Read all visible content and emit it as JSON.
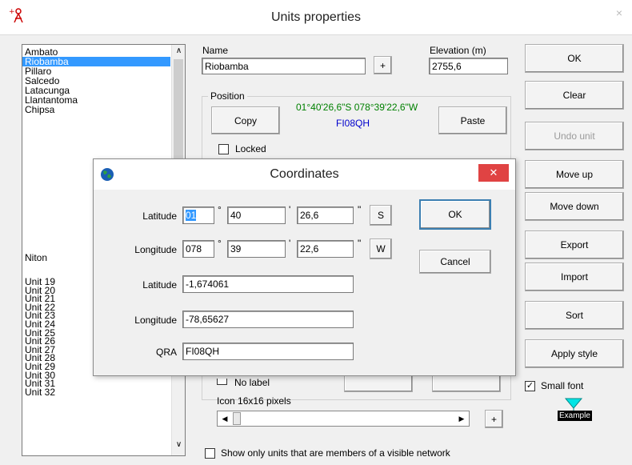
{
  "window": {
    "title": "Units properties",
    "close": "×"
  },
  "unit_list": {
    "top_items": [
      "Ambato",
      "Riobamba",
      "Pillaro",
      "Salcedo",
      "Latacunga",
      "Llantantoma",
      "Chipsa"
    ],
    "selected": "Riobamba",
    "niton": "Niton",
    "units": [
      "Unit  19",
      "Unit  20",
      "Unit  21",
      "Unit  22",
      "Unit  23",
      "Unit  24",
      "Unit  25",
      "Unit  26",
      "Unit  27",
      "Unit  28",
      "Unit  29",
      "Unit  30",
      "Unit  31",
      "Unit  32"
    ]
  },
  "name_field": {
    "label": "Name",
    "value": "Riobamba",
    "plus": "+"
  },
  "elevation": {
    "label": "Elevation (m)",
    "value": "2755,6"
  },
  "position": {
    "label": "Position",
    "coords": "01°40'26,6\"S 078°39'22,6\"W",
    "locator": "FI08QH",
    "copy": "Copy",
    "paste": "Paste",
    "locked": "Locked"
  },
  "bottom": {
    "no_label": "No label",
    "icon_label": "Icon 16x16 pixels",
    "plus": "+",
    "show_only": "Show only units that are members of a visible network"
  },
  "right_buttons": {
    "ok": "OK",
    "clear": "Clear",
    "undo": "Undo unit",
    "move_up": "Move up",
    "move_down": "Move down",
    "export": "Export",
    "import": "Import",
    "sort": "Sort",
    "apply_style": "Apply style"
  },
  "small_font": {
    "label": "Small font",
    "checked": "✓",
    "example": "Example"
  },
  "coordinates": {
    "title": "Coordinates",
    "close": "✕",
    "lat_label": "Latitude",
    "lat_deg": "01",
    "lat_min": "40",
    "lat_sec": "26,6",
    "lat_hemi": "S",
    "lon_label": "Longitude",
    "lon_deg": "078",
    "lon_min": "39",
    "lon_sec": "22,6",
    "lon_hemi": "W",
    "deg_mark": "°",
    "min_mark": "'",
    "sec_mark": "\"",
    "lat_dec_label": "Latitude",
    "lat_dec": "-1,674061",
    "lon_dec_label": "Longitude",
    "lon_dec": "-78,65627",
    "qra_label": "QRA",
    "qra": "FI08QH",
    "ok": "OK",
    "cancel": "Cancel"
  },
  "colors": {
    "coords": "#008000",
    "locator": "#0000cc",
    "selection": "#3399ff",
    "close_red": "#e04343"
  }
}
